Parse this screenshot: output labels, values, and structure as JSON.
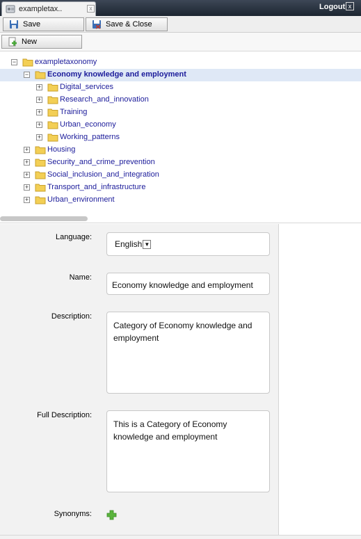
{
  "tab": {
    "title": "exampletax..",
    "close": "x"
  },
  "header": {
    "logout": "Logout",
    "logout_icon": "x"
  },
  "toolbar": {
    "save": "Save",
    "save_close": "Save & Close",
    "new": "New"
  },
  "tree": {
    "root": "exampletaxonomy",
    "selected": "Economy knowledge and employment",
    "children": [
      "Digital_services",
      "Research_and_innovation",
      "Training",
      "Urban_economy",
      "Working_patterns"
    ],
    "siblings": [
      "Housing",
      "Security_and_crime_prevention",
      "Social_inclusion_and_integration",
      "Transport_and_infrastructure",
      "Urban_environment"
    ]
  },
  "form": {
    "language_label": "Language:",
    "language_value": "English",
    "name_label": "Name:",
    "name_value": "Economy knowledge and employment",
    "description_label": "Description:",
    "description_value": "Category of Economy knowledge and employment",
    "full_description_label": "Full Description:",
    "full_description_value": "This is a Category of Economy knowledge and employment",
    "synonyms_label": "Synonyms:"
  },
  "colors": {
    "link": "#1b1b9a",
    "selected_row": "#dfe8f6",
    "topbar": "#2a3340",
    "add_icon": "#5ab43c",
    "folder": "#f3cf55"
  }
}
